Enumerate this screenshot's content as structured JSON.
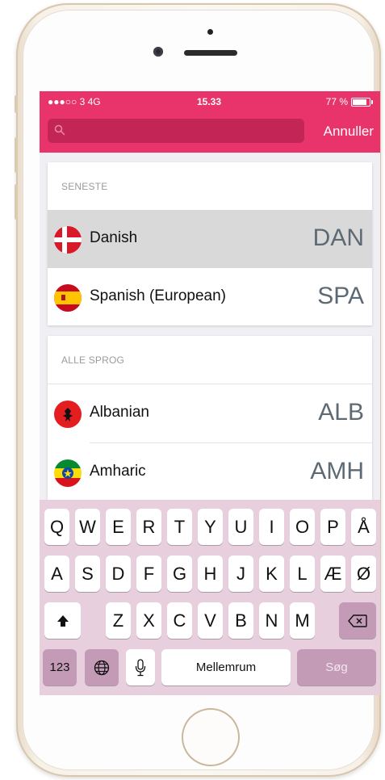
{
  "status_bar": {
    "carrier": "●●●○○ 3   4G",
    "time": "15.33",
    "battery_percent": "77 %",
    "battery_level": 0.77
  },
  "search": {
    "placeholder": "",
    "cancel_label": "Annuller"
  },
  "recent": {
    "title": "SENESTE",
    "items": [
      {
        "name": "Danish",
        "code": "DAN",
        "flag": "denmark-flag",
        "selected": true
      },
      {
        "name": "Spanish (European)",
        "code": "SPA",
        "flag": "spain-flag",
        "selected": false
      }
    ]
  },
  "all_languages": {
    "title": "ALLE SPROG",
    "items": [
      {
        "name": "Albanian",
        "code": "ALB",
        "flag": "albania-flag"
      },
      {
        "name": "Amharic",
        "code": "AMH",
        "flag": "ethiopia-flag"
      }
    ]
  },
  "keyboard": {
    "row1": [
      "Q",
      "W",
      "E",
      "R",
      "T",
      "Y",
      "U",
      "I",
      "O",
      "P",
      "Å"
    ],
    "row2": [
      "A",
      "S",
      "D",
      "F",
      "G",
      "H",
      "J",
      "K",
      "L",
      "Æ",
      "Ø"
    ],
    "row3": [
      "Z",
      "X",
      "C",
      "V",
      "B",
      "N",
      "M"
    ],
    "numbers_label": "123",
    "space_label": "Mellemrum",
    "search_label": "Søg",
    "icons": [
      "shift-icon",
      "backspace-icon",
      "globe-icon",
      "microphone-icon"
    ]
  },
  "colors": {
    "accent": "#e8336b",
    "search_field": "#c22556",
    "keyboard_bg": "#e7cfde",
    "keyboard_dark_key": "#c39bb6"
  }
}
